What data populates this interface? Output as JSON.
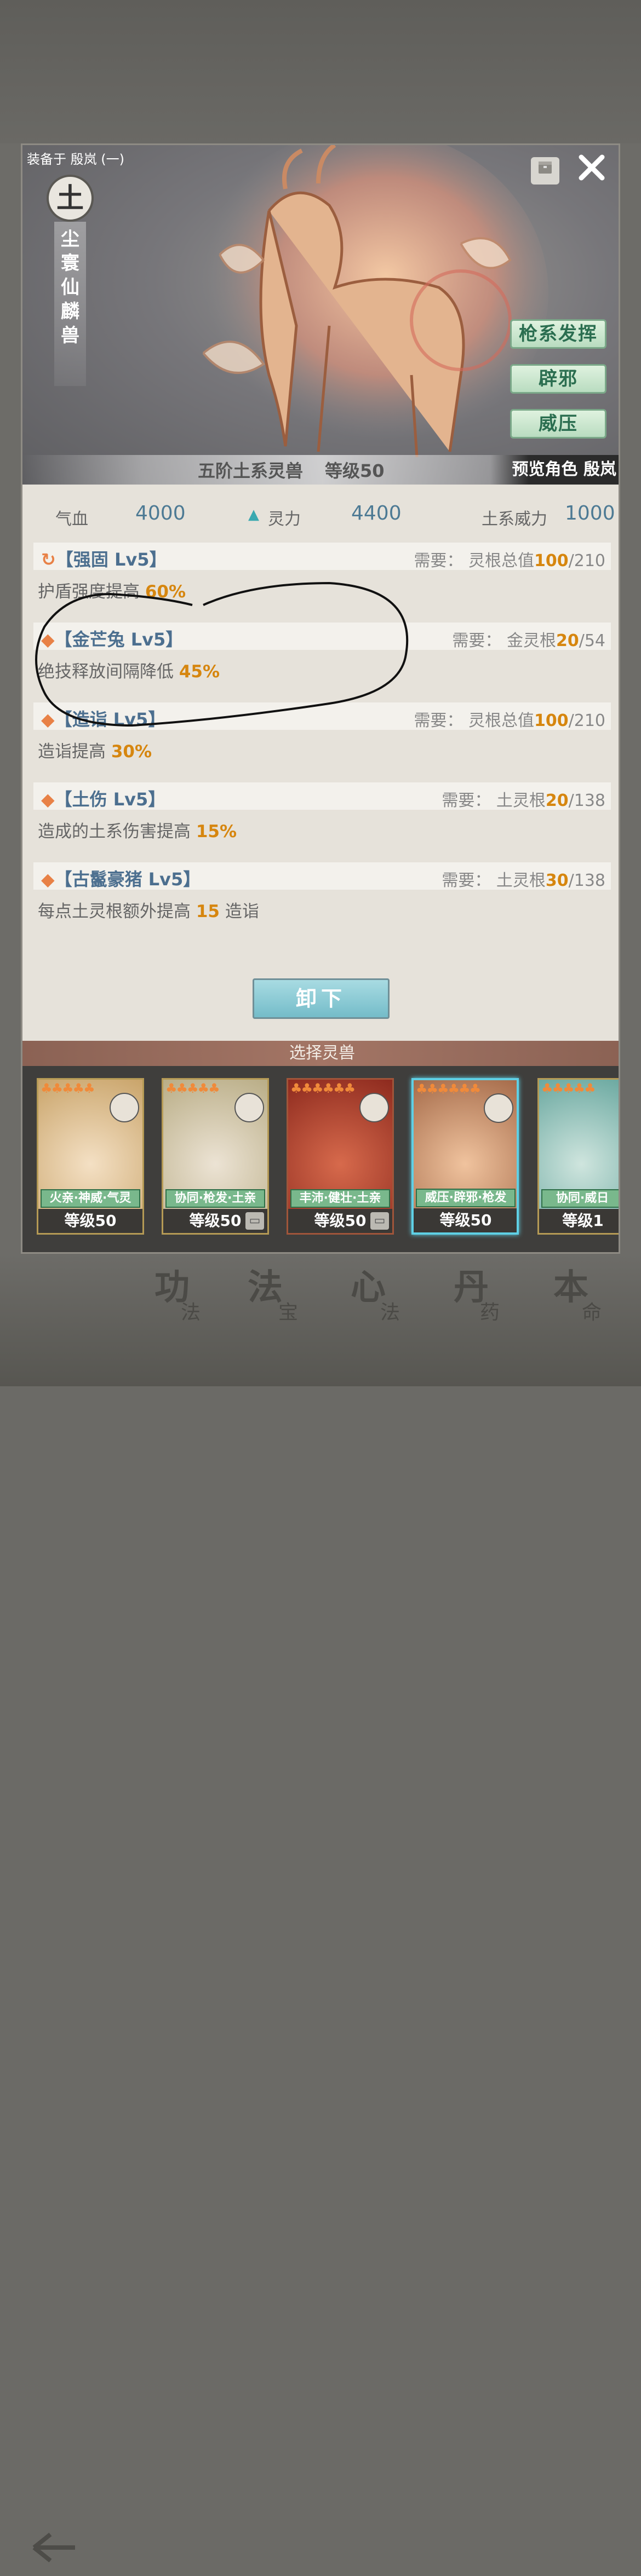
{
  "background": {
    "back_icon": "left-arrow-icon",
    "tabs": [
      {
        "main": "功",
        "sub": "法"
      },
      {
        "main": "法",
        "sub": "宝"
      },
      {
        "main": "心",
        "sub": "法"
      },
      {
        "main": "丹",
        "sub": "药"
      },
      {
        "main": "本",
        "sub": "命"
      }
    ]
  },
  "header": {
    "equipped_label": "装备于 殷岚 (一)",
    "bag_icon": "bag-icon",
    "close_icon": "close-icon"
  },
  "beast": {
    "element": "土",
    "name": "尘寰仙麟兽",
    "traits": [
      "枪系发挥",
      "辟邪",
      "威压"
    ],
    "grade_text": "五阶土系灵兽",
    "level_text": "等级50",
    "preview_text": "预览角色 殷岚"
  },
  "stats": {
    "hp_label": "气血",
    "hp_value": "4000",
    "spirit_label": "灵力",
    "spirit_value": "4400",
    "earth_power_label": "土系威力",
    "earth_power_value": "1000"
  },
  "skills": [
    {
      "name": "【强固 Lv5】",
      "req_prefix": "需要：  灵根总值",
      "req_cur": "100",
      "req_max": "/210",
      "desc_prefix": "护盾强度提高 ",
      "desc_value": "60%",
      "desc_suffix": ""
    },
    {
      "name": "【金芒兔 Lv5】",
      "req_prefix": "需要：  金灵根",
      "req_cur": "20",
      "req_max": "/54",
      "desc_prefix": "绝技释放间隔降低 ",
      "desc_value": "45%",
      "desc_suffix": ""
    },
    {
      "name": "【造诣 Lv5】",
      "req_prefix": "需要：  灵根总值",
      "req_cur": "100",
      "req_max": "/210",
      "desc_prefix": "造诣提高 ",
      "desc_value": "30%",
      "desc_suffix": ""
    },
    {
      "name": "【土伤 Lv5】",
      "req_prefix": "需要：  土灵根",
      "req_cur": "20",
      "req_max": "/138",
      "desc_prefix": "造成的土系伤害提高 ",
      "desc_value": "15%",
      "desc_suffix": ""
    },
    {
      "name": "【古鬣豪猪 Lv5】",
      "req_prefix": "需要：  土灵根",
      "req_cur": "30",
      "req_max": "/138",
      "desc_prefix": "每点土灵根额外提高 ",
      "desc_value": "15",
      "desc_suffix": " 造诣"
    }
  ],
  "unequip_label": "卸下",
  "select_title": "选择灵兽",
  "cards": [
    {
      "stars": "♣♣♣♣♣",
      "tags": "火亲·神威·气灵",
      "level": "等级50",
      "lock": false,
      "color": "#c9a46a"
    },
    {
      "stars": "♣♣♣♣♣",
      "tags": "协同·枪发·土亲",
      "level": "等级50",
      "lock": true,
      "color": "#b9ad86"
    },
    {
      "stars": "♣♣♣♣♣♣",
      "tags": "丰沛·健壮·土亲",
      "level": "等级50",
      "lock": true,
      "color": "#b4402c"
    },
    {
      "stars": "♣♣♣♣♣♣",
      "tags": "威压·辟邪·枪发",
      "level": "等级50",
      "lock": false,
      "color": "#c88a5a"
    },
    {
      "stars": "♣♣♣♣♣",
      "tags": "协同·威日",
      "level": "等级1",
      "lock": false,
      "color": "#6aa8a0"
    }
  ],
  "colors": {
    "highlight": "#d6860f",
    "skill_name": "#4c6f8f",
    "trait_text": "#2b6e50",
    "selected_card": "#5fd0e5"
  }
}
